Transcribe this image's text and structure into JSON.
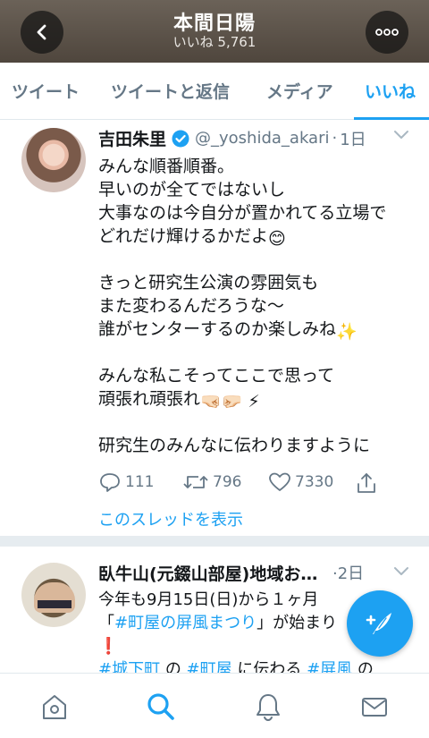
{
  "header": {
    "title": "本間日陽",
    "subtitle": "いいね 5,761",
    "back_icon": "chevron-left-icon",
    "more_icon": "ellipsis-icon"
  },
  "tabs": [
    {
      "label": "ツイート"
    },
    {
      "label": "ツイートと返信"
    },
    {
      "label": "メディア"
    },
    {
      "label": "いいね",
      "active": true
    }
  ],
  "tweets": [
    {
      "name": "吉田朱里",
      "verified": true,
      "handle": "@_yoshida_akari",
      "separator": "·",
      "date": "1日",
      "lines": [
        "みんな順番順番。",
        "早いのが全てではないし",
        "大事なのは今自分が置かれてる立場で",
        "どれだけ輝けるかだよ",
        "",
        "きっと研究生公演の雰囲気も",
        "また変わるんだろうな〜",
        "誰がセンターするのか楽しみね",
        "",
        "みんな私こそってここで思って",
        "頑張れ頑張れ",
        "",
        "研究生のみんなに伝わりますように"
      ],
      "emoji": {
        "smile": "😊",
        "sparkles": "✨",
        "fists": "🤜🏻🤛🏻",
        "bolt": "⚡"
      },
      "replies": "111",
      "retweets": "796",
      "likes": "7330",
      "thread_link": "このスレッドを表示"
    },
    {
      "name": "臥牛山(元錣山部屋)地域おこ…",
      "date": "2日",
      "line1": "今年も9月15日(日)から１ヶ月",
      "line2_pre": "「",
      "line2_tag": "#町屋の屏風まつり",
      "line2_post": "」が始まり",
      "line3": "❗",
      "line4": [
        {
          "text": "#城下町",
          "tag": true
        },
        {
          "text": " の ",
          "tag": false
        },
        {
          "text": "#町屋",
          "tag": true
        },
        {
          "text": " に伝わる ",
          "tag": false
        },
        {
          "text": "#屏風",
          "tag": true
        },
        {
          "text": " の",
          "tag": false
        }
      ]
    }
  ],
  "colors": {
    "accent": "#1da1f2",
    "muted": "#657786",
    "header_bg": "#5a5148",
    "verified": "#1da1f2"
  },
  "bottom_nav": {
    "home_icon": "home-icon",
    "search_icon": "search-icon",
    "notifications_icon": "bell-icon",
    "messages_icon": "envelope-icon"
  },
  "fab": {
    "icon": "compose-tweet-icon"
  }
}
